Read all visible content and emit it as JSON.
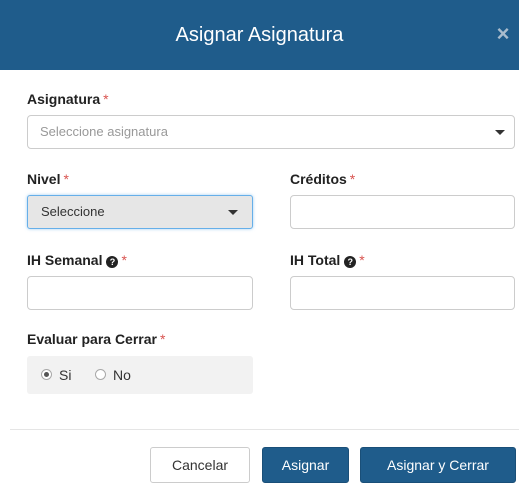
{
  "modal": {
    "title": "Asignar Asignatura",
    "close_symbol": "×"
  },
  "required_mark": "*",
  "fields": {
    "asignatura": {
      "label": "Asignatura",
      "placeholder": "Seleccione asignatura"
    },
    "nivel": {
      "label": "Nivel",
      "selected": "Seleccione"
    },
    "creditos": {
      "label": "Créditos",
      "value": ""
    },
    "ih_semanal": {
      "label": "IH Semanal",
      "help_icon": "question-circle-icon",
      "value": ""
    },
    "ih_total": {
      "label": "IH Total",
      "help_icon": "question-circle-icon",
      "value": ""
    },
    "evaluar": {
      "label": "Evaluar para Cerrar",
      "options": [
        {
          "label": "Si",
          "checked": true
        },
        {
          "label": "No",
          "checked": false
        }
      ]
    }
  },
  "buttons": {
    "cancel": "Cancelar",
    "assign": "Asignar",
    "assign_close": "Asignar y Cerrar"
  },
  "colors": {
    "primary": "#1f5c8b",
    "required": "#d9534f"
  }
}
